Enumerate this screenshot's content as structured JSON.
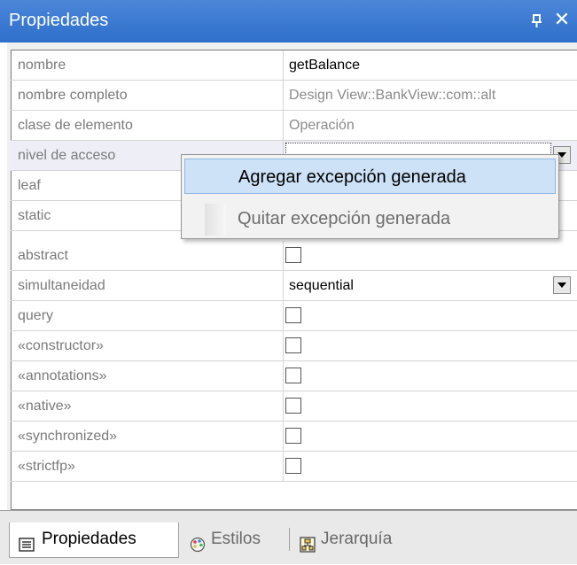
{
  "panel": {
    "title": "Propiedades",
    "pin_glyph": "ᵖ",
    "close_glyph": "✕"
  },
  "properties": [
    {
      "name": "nombre",
      "value": "getBalance",
      "kind": "text"
    },
    {
      "name": "nombre completo",
      "value": "Design View::BankView::com::alt",
      "kind": "text-muted"
    },
    {
      "name": "clase de elemento",
      "value": "Operación",
      "kind": "text-muted"
    },
    {
      "name": "nivel de acceso",
      "value": "",
      "kind": "dropdown-focused"
    },
    {
      "name": "leaf",
      "value": "",
      "kind": "checkbox",
      "checked": false
    },
    {
      "name": "static",
      "value": "",
      "kind": "checkbox",
      "checked": false
    },
    {
      "name": "abstract",
      "value": "",
      "kind": "checkbox",
      "checked": false
    },
    {
      "name": "simultaneidad",
      "value": "sequential",
      "kind": "dropdown"
    },
    {
      "name": "query",
      "value": "",
      "kind": "checkbox",
      "checked": false
    },
    {
      "name": "«constructor»",
      "value": "",
      "kind": "checkbox",
      "checked": false
    },
    {
      "name": "«annotations»",
      "value": "",
      "kind": "checkbox",
      "checked": false
    },
    {
      "name": "«native»",
      "value": "",
      "kind": "checkbox",
      "checked": false
    },
    {
      "name": "«synchronized»",
      "value": "",
      "kind": "checkbox",
      "checked": false
    },
    {
      "name": "«strictfp»",
      "value": "",
      "kind": "checkbox",
      "checked": false
    }
  ],
  "context_menu": {
    "items": [
      {
        "label": "Agregar excepción generada",
        "state": "hover"
      },
      {
        "label": "Quitar excepción generada",
        "state": "disabled"
      }
    ]
  },
  "tabs": [
    {
      "label": "Propiedades",
      "icon": "properties-list-icon",
      "active": true
    },
    {
      "label": "Estilos",
      "icon": "palette-icon",
      "active": false
    },
    {
      "label": "Jerarquía",
      "icon": "hierarchy-icon",
      "active": false
    }
  ],
  "colors": {
    "titlebar": "#3a78d0",
    "menu_hover": "#cde1f7",
    "grid_line": "#d4d4d4",
    "label_text": "#7a7a7a"
  }
}
